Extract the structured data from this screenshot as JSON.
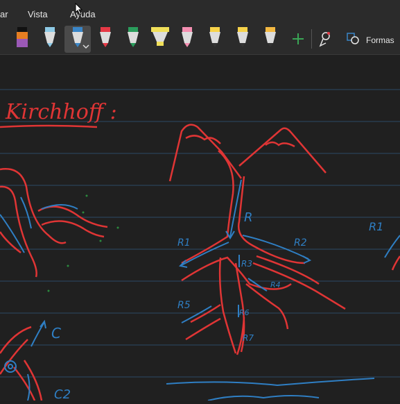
{
  "menu": {
    "items": [
      {
        "label": "ar"
      },
      {
        "label": "Vista"
      },
      {
        "label": "Ayuda"
      }
    ]
  },
  "toolbar": {
    "pens": [
      {
        "name": "pen-purple",
        "color": "#9b59b6"
      },
      {
        "name": "pen-lightblue",
        "color": "#8ecae6"
      },
      {
        "name": "pen-blue",
        "color": "#3a86c8",
        "selected": true
      },
      {
        "name": "pen-red",
        "color": "#e63946"
      },
      {
        "name": "pen-green",
        "color": "#2a9d5c"
      },
      {
        "name": "highlighter-yellow",
        "color": "#f1e05a"
      },
      {
        "name": "pen-pink",
        "color": "#f48fb1"
      },
      {
        "name": "pen-yellow",
        "color": "#f7d34a"
      },
      {
        "name": "pen-yellow-2",
        "color": "#f7d34a"
      },
      {
        "name": "pen-orange",
        "color": "#f4b942"
      }
    ],
    "add_icon": "plus-icon",
    "lasso_icon": "lasso-icon",
    "shapes_label": "Formas"
  },
  "ink": {
    "title": "Kirchhoff :",
    "labels": [
      "R",
      "R1",
      "R2",
      "R3",
      "R4",
      "R5",
      "R6",
      "R7",
      "C",
      "C2",
      "R1"
    ]
  },
  "colors": {
    "background": "#1f1f1f",
    "ruled_line": "#2b4a66",
    "ink_red": "#e03535",
    "ink_blue": "#2f7fc4",
    "ink_green": "#2b8a3e"
  }
}
